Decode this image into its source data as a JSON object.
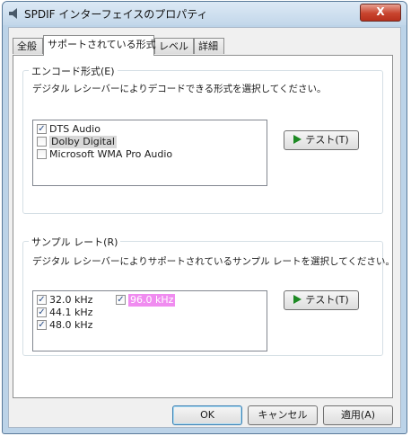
{
  "window": {
    "title": "SPDIF インターフェイスのプロパティ",
    "close_label": "X"
  },
  "tabs": [
    {
      "label": "全般",
      "active": false
    },
    {
      "label": "サポートされている形式",
      "active": true
    },
    {
      "label": "レベル",
      "active": false
    },
    {
      "label": "詳細",
      "active": false
    }
  ],
  "encode_group": {
    "label": "エンコード形式(E)",
    "description": "デジタル レシーバーによりデコードできる形式を選択してください。",
    "items": [
      {
        "label": "DTS Audio",
        "checked": true
      },
      {
        "label": "Dolby Digital",
        "checked": false
      },
      {
        "label": "Microsoft WMA Pro Audio",
        "checked": false
      }
    ],
    "test_button": "テスト(T)"
  },
  "sample_group": {
    "label": "サンプル レート(R)",
    "description": "デジタル レシーバーによりサポートされているサンプル レートを選択してください。",
    "items": [
      {
        "label": "32.0 kHz",
        "checked": true
      },
      {
        "label": "44.1 kHz",
        "checked": true
      },
      {
        "label": "48.0 kHz",
        "checked": true
      },
      {
        "label": "96.0 kHz",
        "checked": true
      }
    ],
    "test_button": "テスト(T)"
  },
  "footer": {
    "ok": "OK",
    "cancel": "キャンセル",
    "apply": "適用(A)"
  },
  "check_mark": "✓",
  "colors": {
    "title_bar": "#c3d7ea",
    "close_button": "#c8442e",
    "play_icon": "#1e8a24",
    "highlight_pink": "#f08cf0"
  }
}
